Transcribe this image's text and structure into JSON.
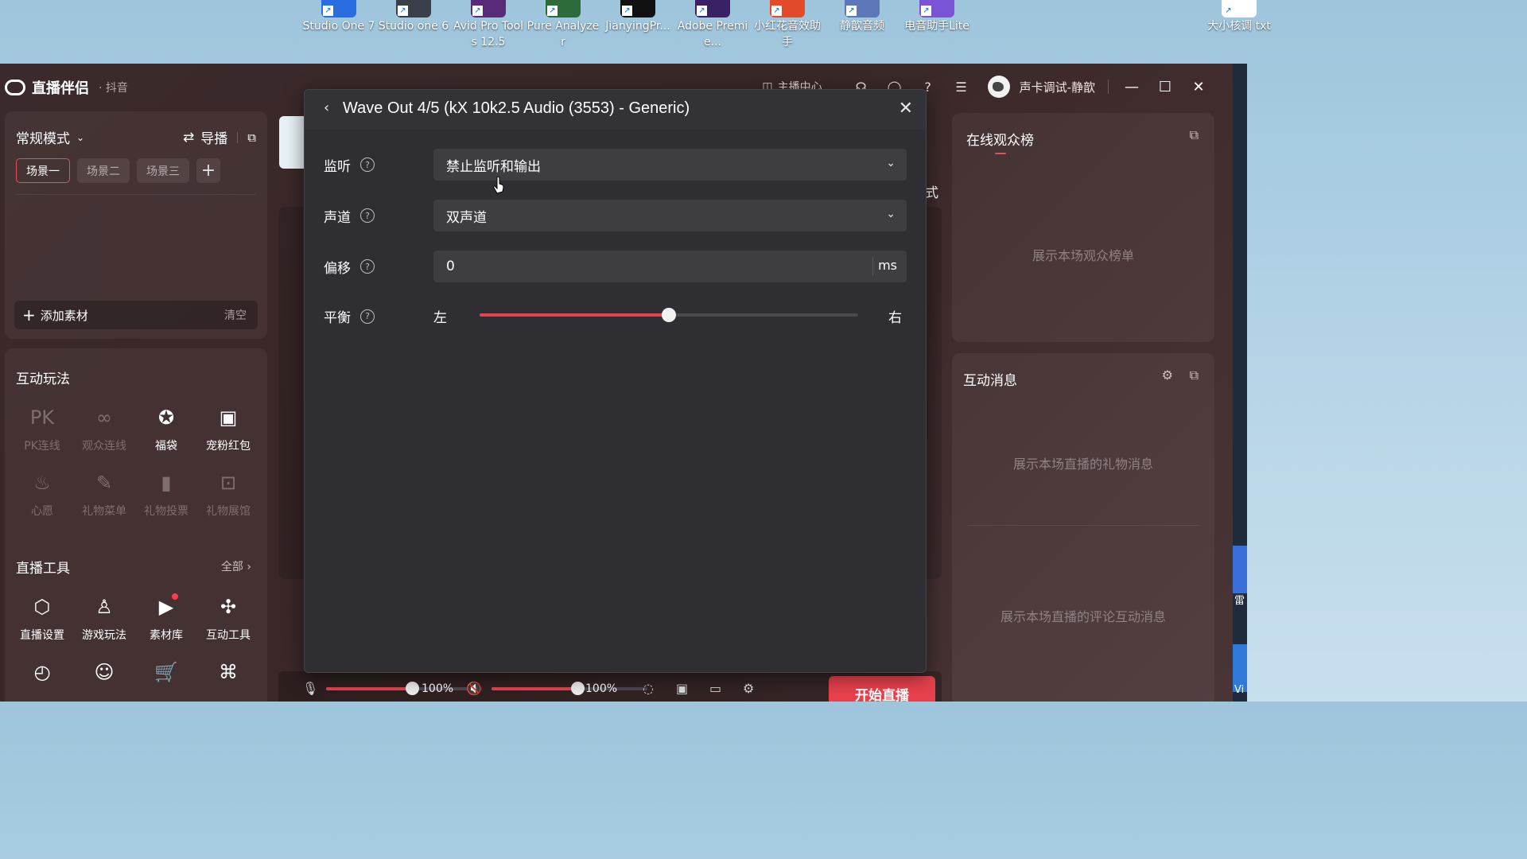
{
  "desktop": {
    "icons": [
      {
        "label": "Studio One 7",
        "color": "#2a6de0"
      },
      {
        "label": "Studio one 6",
        "color": "#3b3f4b"
      },
      {
        "label": "Avid Pro Tools 12.5",
        "color": "#5a2a7a"
      },
      {
        "label": "Pure Analyzer",
        "color": "#2e6b3a"
      },
      {
        "label": "JianyingPr...",
        "color": "#111111"
      },
      {
        "label": "Adobe Premie...",
        "color": "#3a2166"
      },
      {
        "label": "小红花音效助手",
        "color": "#e34a2a"
      },
      {
        "label": "静歆音频",
        "color": "#5d77b8"
      },
      {
        "label": "电音助手Lite",
        "color": "#7b54d6"
      },
      {
        "label": "大小核调 txt",
        "color": "#ffffff"
      }
    ]
  },
  "app": {
    "name": "直播伴侣",
    "platform": "· 抖音",
    "header_center": "主播中心",
    "username": "声卡调试-静歆",
    "left": {
      "mode": "常规模式",
      "guide": "导播",
      "scenes": [
        "场景一",
        "场景二",
        "场景三"
      ],
      "add_material": "添加素材",
      "clear": "清空",
      "interactive_title": "互动玩法",
      "interactive_tools": [
        {
          "label": "PK连线",
          "icon": "PK",
          "dim": true
        },
        {
          "label": "观众连线",
          "icon": "∞",
          "dim": true
        },
        {
          "label": "福袋",
          "icon": "✪",
          "dim": false
        },
        {
          "label": "宠粉红包",
          "icon": "▣",
          "dim": false
        },
        {
          "label": "心愿",
          "icon": "♨",
          "dim": true
        },
        {
          "label": "礼物菜单",
          "icon": "✎",
          "dim": true
        },
        {
          "label": "礼物投票",
          "icon": "▮",
          "dim": true
        },
        {
          "label": "礼物展馆",
          "icon": "⊡",
          "dim": true
        }
      ],
      "live_tools_title": "直播工具",
      "live_tools_more": "全部",
      "live_tools": [
        {
          "label": "直播设置",
          "icon": "⬡"
        },
        {
          "label": "游戏玩法",
          "icon": "♙"
        },
        {
          "label": "素材库",
          "icon": "▶"
        },
        {
          "label": "互动工具",
          "icon": "✣"
        },
        {
          "label": "",
          "icon": "◴"
        },
        {
          "label": "",
          "icon": "☺"
        },
        {
          "label": "",
          "icon": "🛒"
        },
        {
          "label": "",
          "icon": "⌘"
        }
      ]
    },
    "center": {
      "peek_text": "式",
      "mic_volume": "100%",
      "speaker_volume": "100%",
      "mic_level": 0.55,
      "speaker_level": 0.55,
      "start_button": "开始直播"
    },
    "right": {
      "viewers_title": "在线观众榜",
      "viewers_empty": "展示本场观众榜单",
      "messages_title": "互动消息",
      "gift_empty": "展示本场直播的礼物消息",
      "comment_empty": "展示本场直播的评论互动消息"
    }
  },
  "modal": {
    "title": "Wave Out 4/5 (kX 10k2.5 Audio (3553) - Generic)",
    "monitor_label": "监听",
    "monitor_value": "禁止监听和输出",
    "channel_label": "声道",
    "channel_value": "双声道",
    "offset_label": "偏移",
    "offset_value": "0",
    "offset_unit": "ms",
    "balance_label": "平衡",
    "balance_left": "左",
    "balance_right": "右",
    "balance_level": 0.5
  },
  "external_strip": {
    "text1": "雷",
    "text2": "Vi"
  }
}
